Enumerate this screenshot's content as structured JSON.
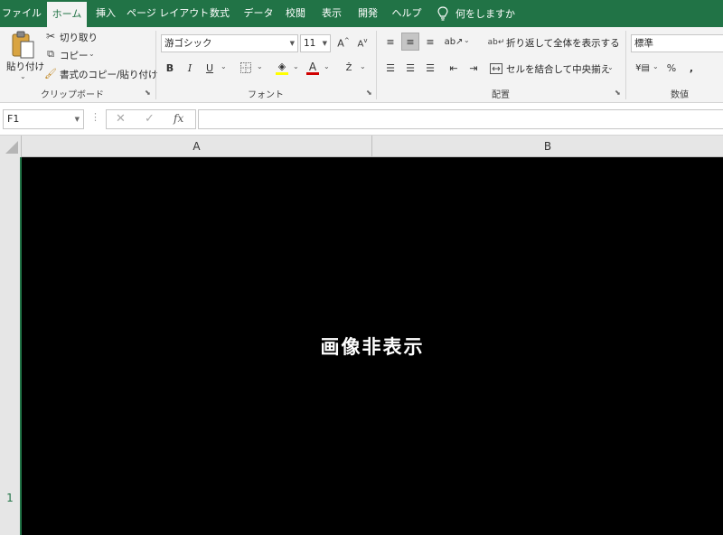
{
  "tabs": [
    {
      "label": "ファイル"
    },
    {
      "label": "ホーム"
    },
    {
      "label": "挿入"
    },
    {
      "label": "ページ レイアウト"
    },
    {
      "label": "数式"
    },
    {
      "label": "データ"
    },
    {
      "label": "校閲"
    },
    {
      "label": "表示"
    },
    {
      "label": "開発"
    },
    {
      "label": "ヘルプ"
    }
  ],
  "tell_me": {
    "label": "何をしますか",
    "icon": "lightbulb-icon"
  },
  "clipboard": {
    "paste_label": "貼り付け",
    "cut_label": "切り取り",
    "copy_label": "コピー",
    "format_painter_label": "書式のコピー/貼り付け",
    "group_label": "クリップボード"
  },
  "font": {
    "name": "游ゴシック",
    "size": "11",
    "bold": "B",
    "italic": "I",
    "underline": "U",
    "group_label": "フォント",
    "font_color": "#d00000",
    "highlight_color": "#ffff00"
  },
  "alignment": {
    "wrap_label": "折り返して全体を表示する",
    "merge_label": "セルを結合して中央揃え",
    "group_label": "配置"
  },
  "number": {
    "format": "標準",
    "percent": "%",
    "comma": ",",
    "group_label": "数値"
  },
  "formula_bar": {
    "name_box": "F1",
    "fx": "fx",
    "value": ""
  },
  "grid": {
    "columns": [
      "A",
      "B"
    ],
    "rows": [
      "1"
    ],
    "hidden_image_text": "画像非表示"
  },
  "colors": {
    "accent": "#217346"
  }
}
